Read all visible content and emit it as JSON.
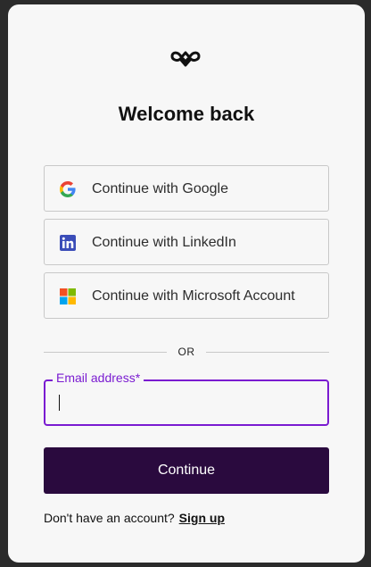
{
  "header": {
    "logo_icon": "infinity-logo-icon",
    "title": "Welcome back"
  },
  "sso": [
    {
      "label": "Continue with Google",
      "icon": "google-icon"
    },
    {
      "label": "Continue with LinkedIn",
      "icon": "linkedin-icon"
    },
    {
      "label": "Continue with Microsoft Account",
      "icon": "microsoft-icon"
    }
  ],
  "divider": {
    "text": "OR"
  },
  "email": {
    "label": "Email address*",
    "value": "",
    "placeholder": ""
  },
  "continue": {
    "label": "Continue"
  },
  "signup": {
    "prompt": "Don't have an account?",
    "link": "Sign up"
  },
  "colors": {
    "accent": "#7a1bd1",
    "primary_button": "#2a0a3e",
    "card_background": "#f7f7f7",
    "page_background": "#2b2b2b"
  }
}
